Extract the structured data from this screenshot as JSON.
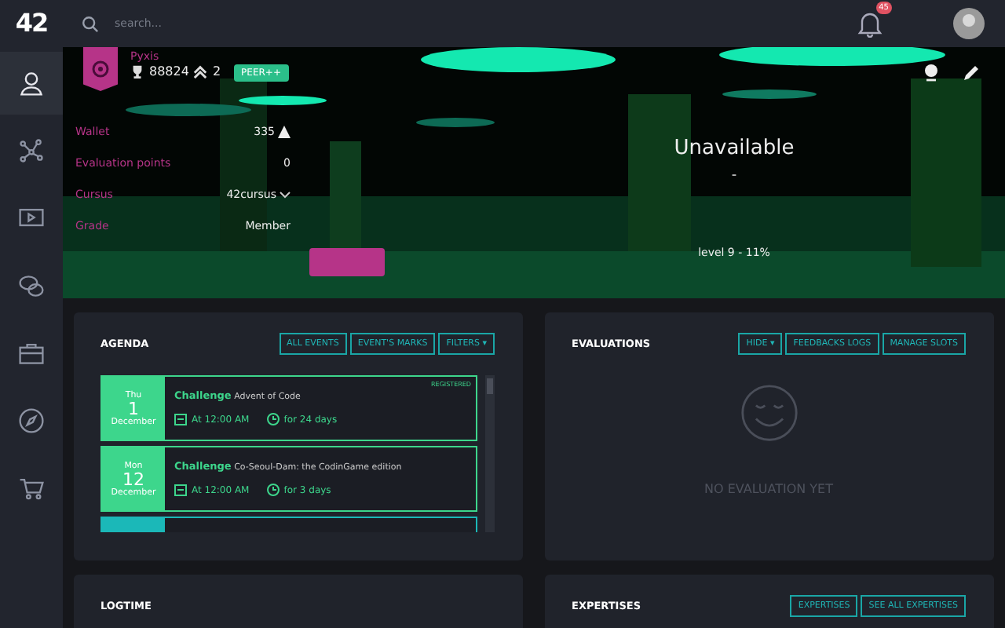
{
  "logo": "42",
  "sidebar": {
    "items": [
      {
        "selected": true
      },
      {
        "selected": false
      },
      {
        "selected": false
      },
      {
        "selected": false
      },
      {
        "selected": false
      },
      {
        "selected": false
      },
      {
        "selected": false
      }
    ]
  },
  "topbar": {
    "search": {
      "placeholder": "search..."
    },
    "notifications": "45"
  },
  "profile": {
    "name": "Pyxis",
    "points": "88824",
    "rank": "2",
    "badge": "PEER++",
    "stats": [
      {
        "label": "Wallet",
        "value": "335",
        "kind": "coins"
      },
      {
        "label": "Evaluation points",
        "value": "0",
        "kind": "plain"
      },
      {
        "label": "Cursus",
        "value": "42cursus",
        "kind": "select"
      },
      {
        "label": "Grade",
        "value": "Member",
        "kind": "plain"
      }
    ],
    "title": "Unavailable",
    "subtitle": "-",
    "level_text": "level 9 - 11%"
  },
  "agenda": {
    "title": "AGENDA",
    "buttons": [
      "ALL EVENTS",
      "EVENT'S MARKS",
      "FILTERS ▾"
    ],
    "events": [
      {
        "weekday": "Thu",
        "day": "1",
        "month": "December",
        "type": "Challenge",
        "name": "Advent of Code",
        "time": "At 12:00 AM",
        "duration": "for 24 days",
        "status": "REGISTERED",
        "color": "#3dd68c"
      },
      {
        "weekday": "Mon",
        "day": "12",
        "month": "December",
        "type": "Challenge",
        "name": "Co-Seoul-Dam: the CodinGame edition",
        "time": "At 12:00 AM",
        "duration": "for 3 days",
        "color": "#3dd68c"
      },
      {
        "color": "#1bb8b8"
      }
    ]
  },
  "evaluations": {
    "title": "EVALUATIONS",
    "buttons": [
      "HIDE ▾",
      "FEEDBACKS LOGS",
      "MANAGE SLOTS"
    ],
    "empty": "NO EVALUATION YET"
  },
  "logtime": {
    "title": "LOGTIME"
  },
  "expertises": {
    "title": "EXPERTISES",
    "buttons": [
      "EXPERTISES",
      "SEE ALL EXPERTISES"
    ]
  }
}
